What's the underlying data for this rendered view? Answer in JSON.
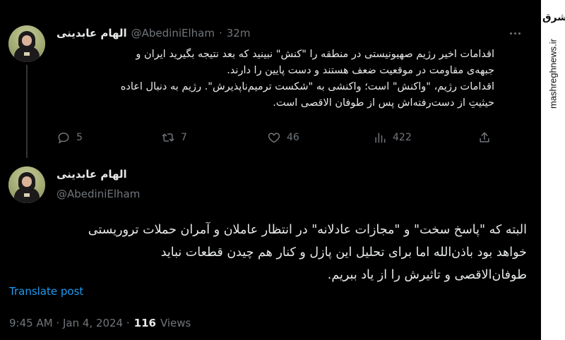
{
  "watermark": {
    "logo_text": "مشرق",
    "url": "mashreghnews.ir"
  },
  "tweet1": {
    "display_name": "الهام عابدینی",
    "handle": "@AbediniElham",
    "separator": "·",
    "time": "32m",
    "lines": [
      "اقدامات اخیر رژیم صهیونیستی در منطقه را \"کنش\" نبینید که بعد نتیجه بگیرید ایران و",
      "جبهه‌ی مقاومت در موقعیت ضعف هستند و دست پایین را دارند.",
      "اقدامات رژیم، \"واکنش\" است؛ واکنشی به \"شکست ترمیم‌ناپذیرش\". رژیم به دنبال اعاده",
      "حیثیتِ از دست‌رفته‌اش پس از طوفان الاقصی است."
    ],
    "stats": {
      "replies": "5",
      "reposts": "7",
      "likes": "46",
      "views": "422"
    }
  },
  "tweet2": {
    "display_name": "الهام عابدینی",
    "handle": "@AbediniElham",
    "lines": [
      "البته که \"پاسخ سخت\" و \"مجازات عادلانه\" در انتظار عاملان و آمران حملات تروریستی",
      "خواهد بود باذن‌الله اما برای تحلیل این پازل و کنار هم چیدن قطعات نباید",
      "طوفان‌الاقصی و تاثیرش را از یاد ببریم."
    ],
    "translate_label": "Translate post",
    "timestamp": "9:45 AM · Jan 4, 2024 ·",
    "views_count": "116",
    "views_label": "Views"
  }
}
